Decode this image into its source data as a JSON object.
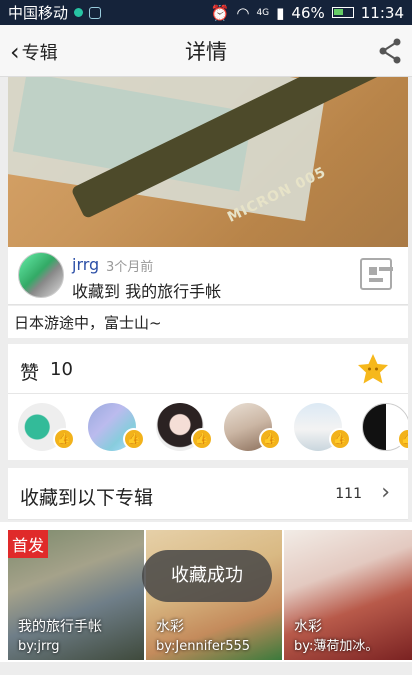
{
  "status_bar": {
    "carrier": "中国移动",
    "network": "4G",
    "battery": "46%",
    "time": "11:34"
  },
  "navbar": {
    "back_label": "专辑",
    "title": "详情"
  },
  "post": {
    "username": "jrrg",
    "time_ago": "3个月前",
    "action_text": "收藏到 我的旅行手帐",
    "description": "日本游途中，富士山~",
    "hero_pen_text": "MICRON 005"
  },
  "likes": {
    "label": "赞",
    "count": "10"
  },
  "albums_section": {
    "title": "收藏到以下专辑",
    "count": "111"
  },
  "albums": [
    {
      "name": "我的旅行手帐",
      "by": "by:jrrg",
      "badge": "首发"
    },
    {
      "name": "水彩",
      "by": "by:Jennifer555",
      "badge": ""
    },
    {
      "name": "水彩",
      "by": "by:薄荷加冰。",
      "badge": ""
    }
  ],
  "toast": "收藏成功",
  "colors": {
    "status_bar": "#15233a",
    "username": "#2c4fa7",
    "star": "#f6b81c",
    "badge": "#e02a2a"
  }
}
